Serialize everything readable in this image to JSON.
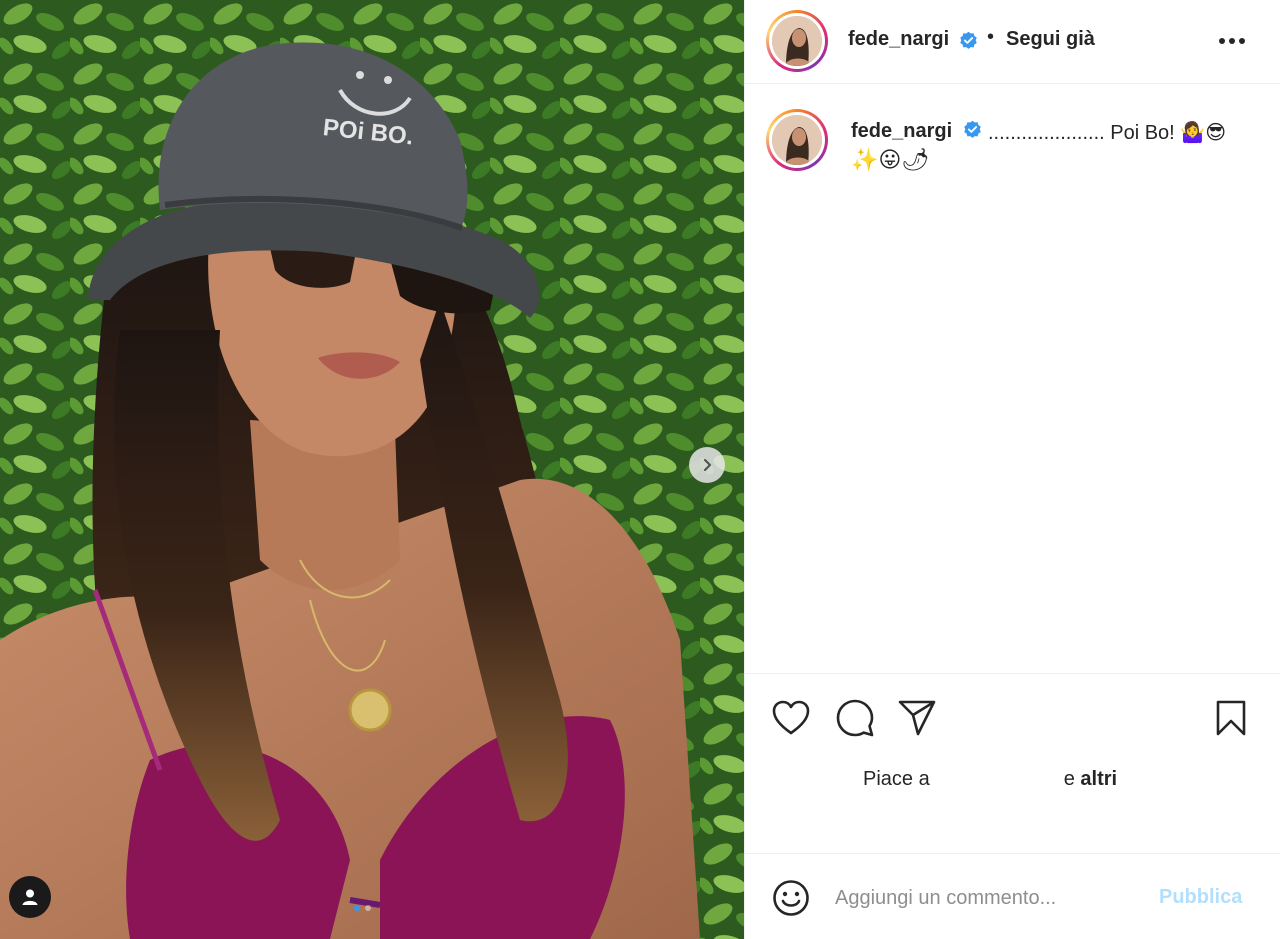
{
  "post": {
    "username": "fede_nargi",
    "follow_status": "Segui già",
    "separator": "•",
    "hat_text": "POi BO."
  },
  "caption": {
    "username": "fede_nargi",
    "text": "..................... Poi Bo! 🤷‍♀️😎",
    "text_line2": "✨😛🌶"
  },
  "actions": {
    "likes_prefix": "Piace a",
    "likes_suffix": "e",
    "likes_others": "altri"
  },
  "comment_box": {
    "placeholder": "Aggiungi un commento...",
    "post_label": "Pubblica"
  },
  "carousel": {
    "total_slides": 2,
    "current_slide": 1
  },
  "colors": {
    "verified": "#3897f0",
    "post_button_disabled": "#b2dffc",
    "bikini": "#8b1457",
    "hat": "#4a4d50"
  },
  "icons": {
    "like": "heart-icon",
    "comment": "comment-bubble-icon",
    "share": "paper-plane-icon",
    "save": "bookmark-icon",
    "emoji": "smiley-icon",
    "more": "ellipsis-icon",
    "next": "chevron-right-icon",
    "tags": "user-tag-icon",
    "verified": "verified-badge-icon"
  }
}
